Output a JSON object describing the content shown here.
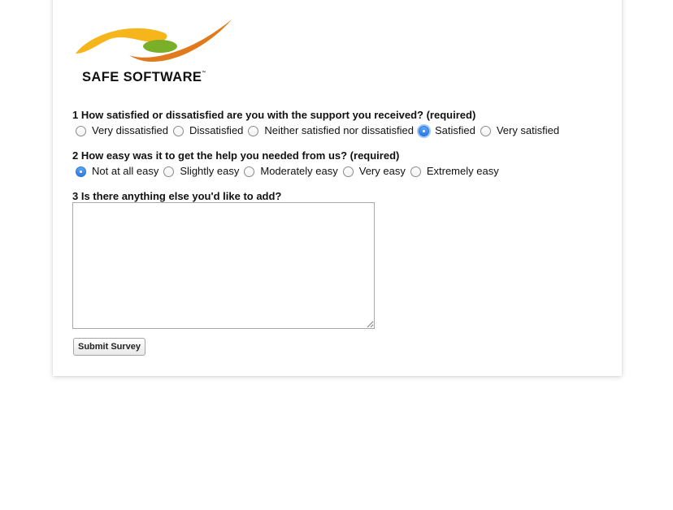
{
  "brand": {
    "name": "SAFE SOFTWARE",
    "trademark": "™",
    "colors": {
      "yellow": "#f7b51c",
      "orange": "#e07a1c",
      "green": "#7aaf2a"
    }
  },
  "questions": [
    {
      "label": "1 How satisfied or dissatisfied are you with the support you received? (required)",
      "options": [
        "Very dissatisfied",
        "Dissatisfied",
        "Neither satisfied nor dissatisfied",
        "Satisfied",
        "Very satisfied"
      ],
      "selected": "Satisfied"
    },
    {
      "label": "2 How easy was it to get the help you needed from us? (required)",
      "options": [
        "Not at all easy",
        "Slightly easy",
        "Moderately easy",
        "Very easy",
        "Extremely easy"
      ],
      "selected": "Not at all easy"
    },
    {
      "label": "3 Is there anything else you'd like to add?",
      "value": ""
    }
  ],
  "submit_label": "Submit Survey",
  "accent_color": "#2a7be4"
}
